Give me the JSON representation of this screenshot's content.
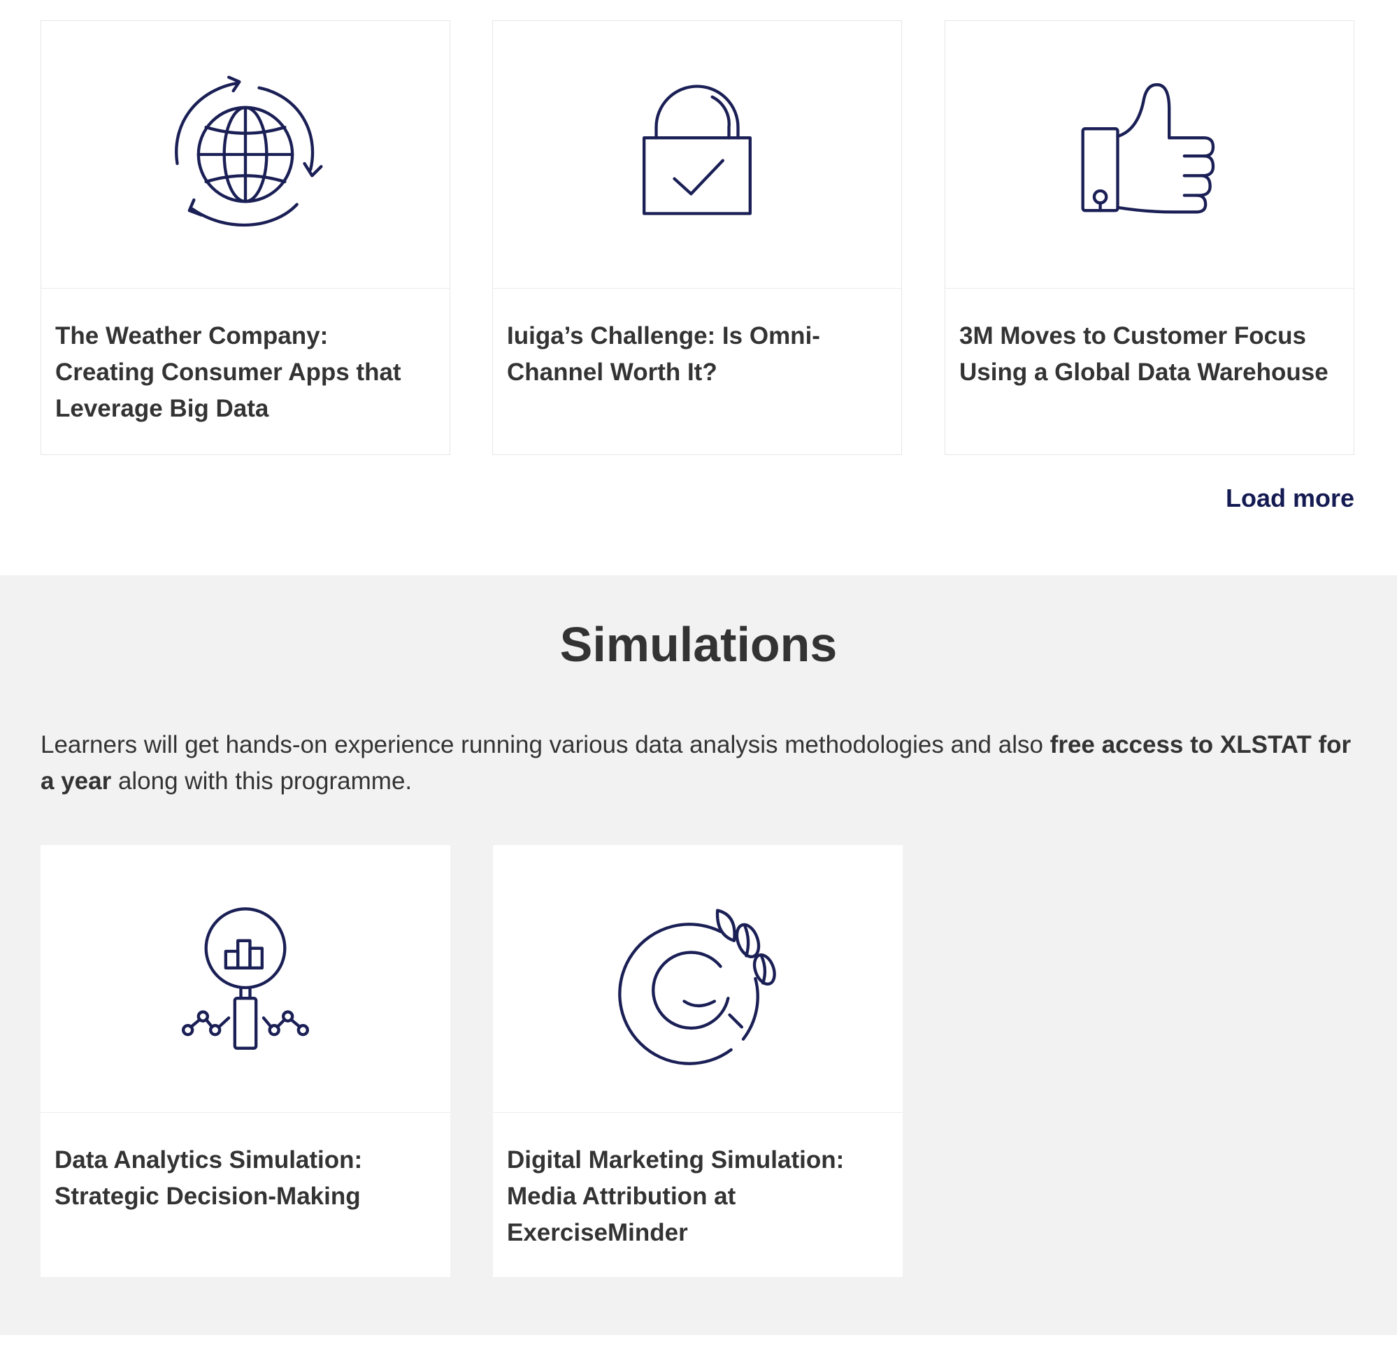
{
  "case_studies": {
    "cards": [
      {
        "title": "The Weather Company: Creating Consumer Apps that Leverage Big Data",
        "icon": "globe-cycle-icon"
      },
      {
        "title": "Iuiga’s Challenge: Is Omni-Channel Worth It?",
        "icon": "padlock-check-icon"
      },
      {
        "title": "3M Moves to Customer Focus Using a Global Data Warehouse",
        "icon": "thumbs-up-icon"
      }
    ],
    "load_more_label": "Load more"
  },
  "simulations": {
    "heading": "Simulations",
    "intro_start": "Learners will get hands-on experience running various data analysis methodologies and also ",
    "intro_bold": "free access to XLSTAT for a year",
    "intro_end": " along with this programme.",
    "cards": [
      {
        "title": "Data Analytics Simulation: Strategic Decision-Making",
        "icon": "magnifier-chart-icon"
      },
      {
        "title": "Digital Marketing Simulation: Media Attribution at ExerciseMinder",
        "icon": "coffee-cup-icon"
      }
    ]
  },
  "colors": {
    "icon_stroke": "#1a1f55",
    "link": "#141a52",
    "section_bg": "#f2f2f2",
    "text": "#333333"
  }
}
